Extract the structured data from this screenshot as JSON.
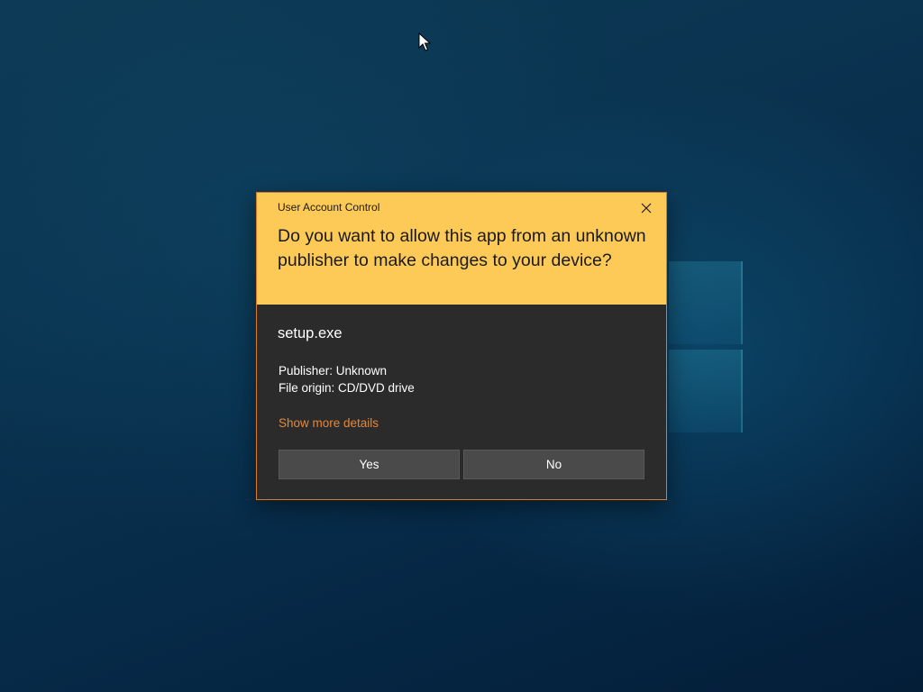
{
  "dialog": {
    "caption": "User Account Control",
    "question": "Do you want to allow this app from an unknown publisher to make changes to your device?",
    "app_name": "setup.exe",
    "publisher": "Publisher: Unknown",
    "file_origin": "File origin: CD/DVD drive",
    "details_link": "Show more details",
    "yes_label": "Yes",
    "no_label": "No"
  },
  "icons": {
    "close": "close-icon",
    "cursor": "mouse-pointer-icon",
    "logo": "windows-logo-icon"
  },
  "colors": {
    "header_bg": "#fdca57",
    "body_bg": "#2b2b2b",
    "border": "#e07a20",
    "link": "#e5873a",
    "button_bg": "#4a4a4a"
  }
}
